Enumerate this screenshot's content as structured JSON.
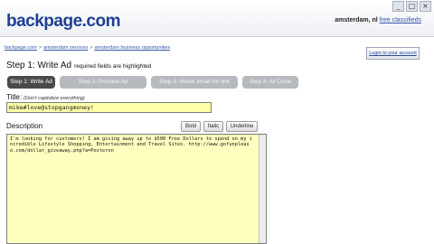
{
  "header": {
    "logo": "backpage.com",
    "location_city": "amsterdam, nl",
    "location_link": "free classifieds",
    "window_buttons": [
      "_",
      "□",
      "×"
    ]
  },
  "breadcrumb": [
    "backpage.com",
    "amsterdam services",
    "amsterdam business opportunities"
  ],
  "account_button": "Login to your account",
  "step": {
    "title": "Step 1: Write Ad",
    "note": "required fields are highlighted"
  },
  "steps": [
    {
      "label": "Step 1: Write Ad",
      "active": true
    },
    {
      "label": "Step 2: Preview Ad",
      "active": false
    },
    {
      "label": "Step 3: check email for link",
      "active": false
    },
    {
      "label": "Step 4: All Done",
      "active": false
    }
  ],
  "title_field": {
    "label": "Title:",
    "hint": "(Don't capitalize everything)",
    "value": "mike#love@stopgangmoney!"
  },
  "description": {
    "label": "Description",
    "buttons": [
      "Bold",
      "Italic",
      "Underline"
    ],
    "text": "I'm looking for customers! I am giving away up to $500 Free Dollars to spend on my incredible Lifestyle Shopping, Entertainment and Travel Sites. http://www.gofunplease.com/dollar_giveaway.php?a=Pesteron"
  }
}
